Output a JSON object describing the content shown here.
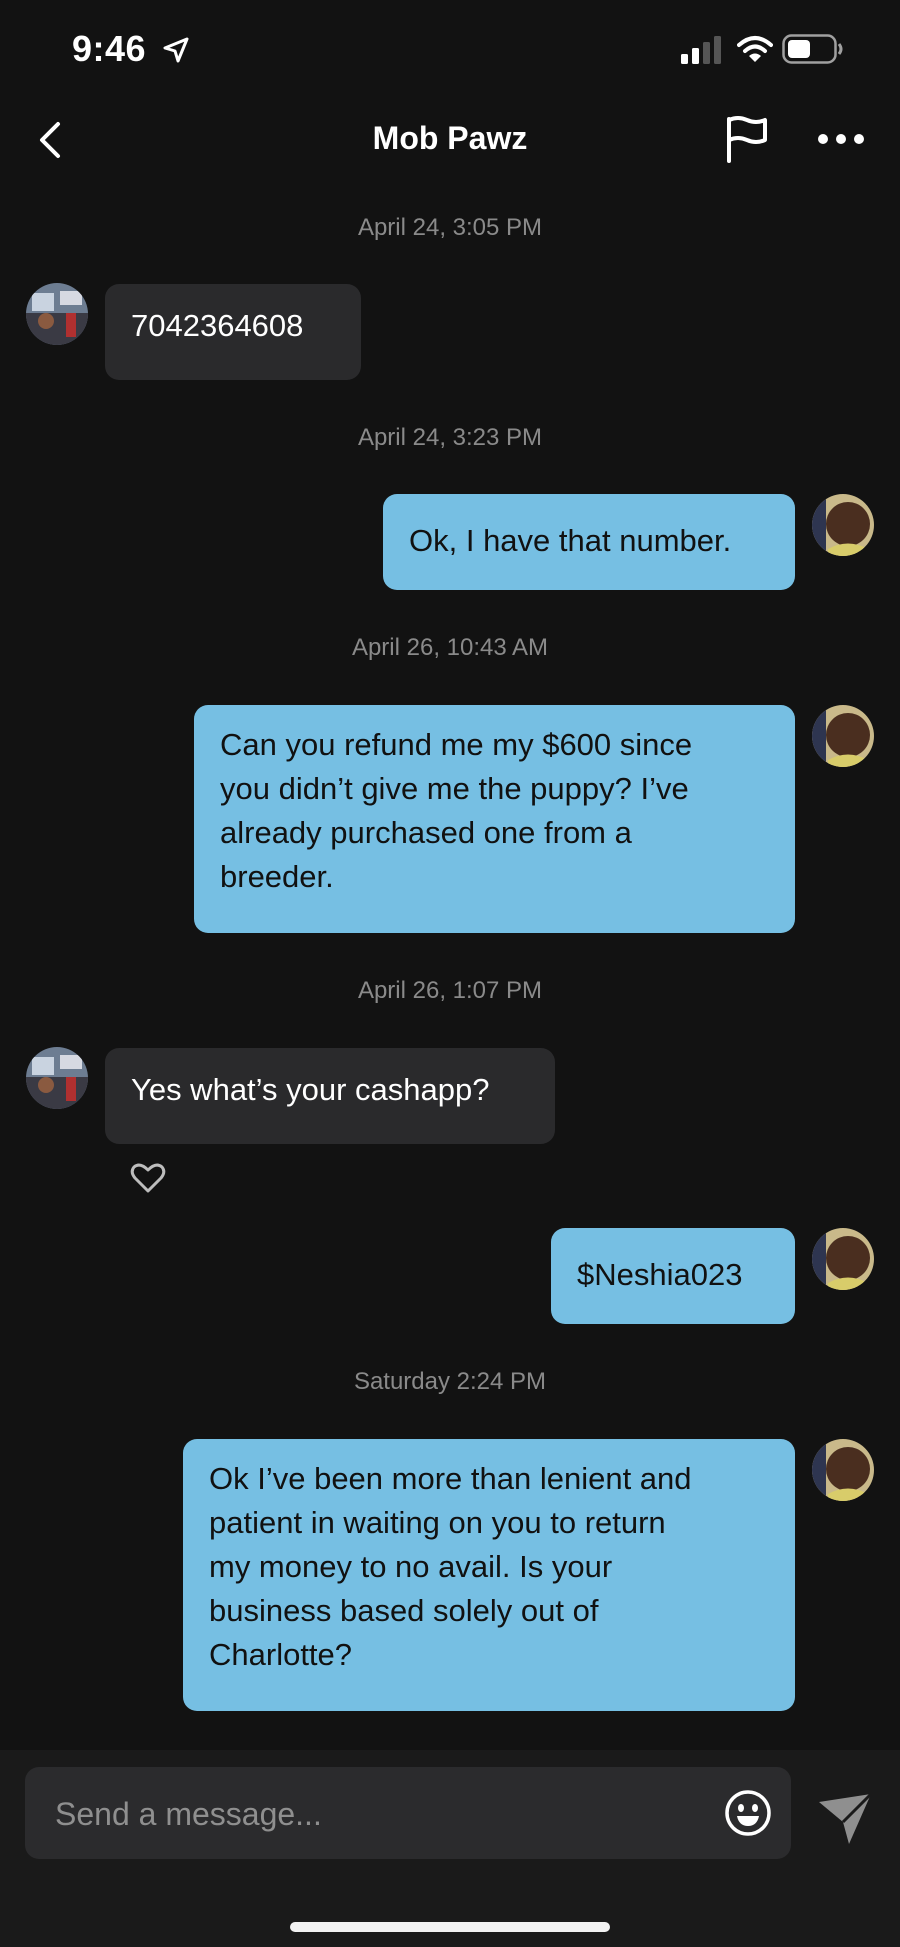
{
  "status_bar": {
    "time": "9:46",
    "icons": [
      "location-arrow-icon",
      "signal-icon",
      "wifi-icon",
      "battery-icon"
    ]
  },
  "header": {
    "title": "Mob Pawz",
    "icons": [
      "back-icon",
      "flag-icon",
      "more-icon"
    ]
  },
  "messages": [
    {
      "timestamp": "April 24, 3:05 PM",
      "direction": "incoming",
      "text": "7042364608"
    },
    {
      "timestamp": "April 24, 3:23 PM",
      "direction": "outgoing",
      "text": "Ok, I have that number."
    },
    {
      "timestamp": "April 26, 10:43 AM",
      "direction": "outgoing",
      "lines": [
        "Can you refund me my $600 since",
        "you didn’t give me the puppy? I’ve",
        "already purchased one from a",
        "breeder."
      ]
    },
    {
      "timestamp": "April 26, 1:07 PM",
      "direction": "incoming",
      "text": "Yes what’s your cashapp?",
      "reaction_icon": "heart-icon"
    },
    {
      "direction": "outgoing",
      "text": "$Neshia023"
    },
    {
      "timestamp": "Saturday 2:24 PM",
      "direction": "outgoing",
      "lines": [
        "Ok I’ve been more than lenient and",
        "patient in waiting on you to return",
        "my money to no avail. Is your",
        "business based solely out of",
        "Charlotte?"
      ]
    }
  ],
  "composer": {
    "placeholder": "Send a message...",
    "value": "",
    "icons": [
      "emoji-icon",
      "send-icon"
    ]
  },
  "colors": {
    "background": "#121212",
    "incoming_bubble": "#2a2a2c",
    "outgoing_bubble": "#76bfe3",
    "timestamp_text": "#8a8a8a"
  }
}
